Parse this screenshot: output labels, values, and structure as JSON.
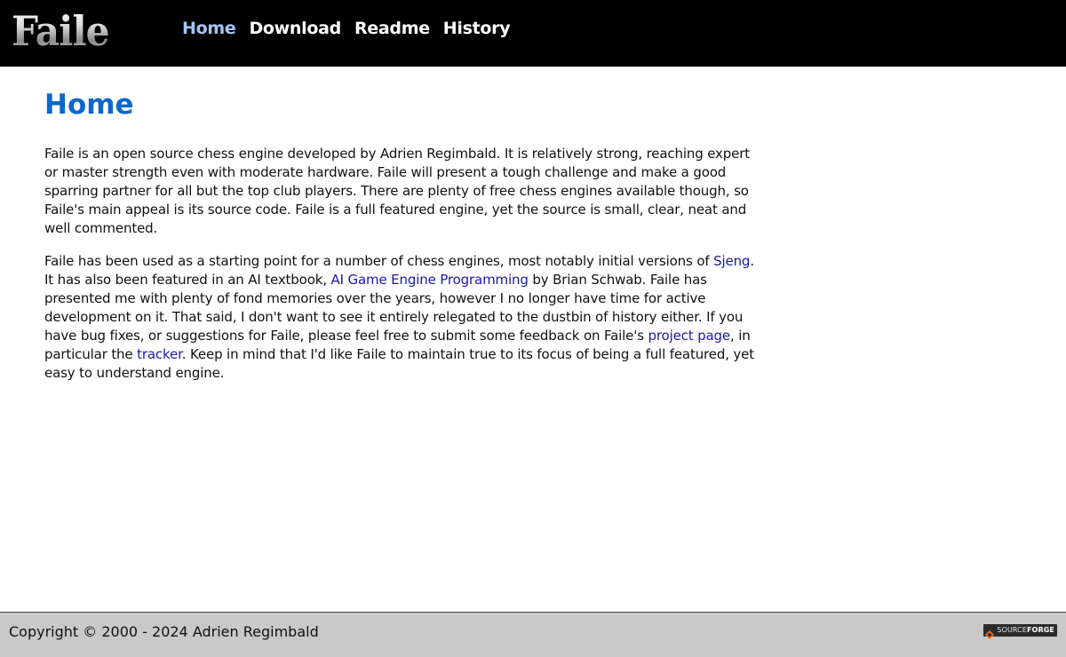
{
  "header": {
    "logo_text": "Faile",
    "nav": [
      {
        "label": "Home",
        "active": true
      },
      {
        "label": "Download",
        "active": false
      },
      {
        "label": "Readme",
        "active": false
      },
      {
        "label": "History",
        "active": false
      }
    ]
  },
  "main": {
    "title": "Home",
    "p1": "Faile is an open source chess engine developed by Adrien Regimbald. It is relatively strong, reaching expert or master strength even with moderate hardware. Faile will present a tough challenge and make a good sparring partner for all but the top club players. There are plenty of free chess engines available though, so Faile's main appeal is its source code. Faile is a full featured engine, yet the source is small, clear, neat and well commented.",
    "p2": {
      "t1": "Faile has been used as a starting point for a number of chess engines, most notably initial versions of ",
      "link_sjeng": "Sjeng",
      "t2": ". It has also been featured in an AI textbook, ",
      "link_book": "AI Game Engine Programming",
      "t3": " by Brian Schwab. Faile has presented me with plenty of fond memories over the years, however I no longer have time for active development on it. That said, I don't want to see it entirely relegated to the dustbin of history either. If you have bug fixes, or suggestions for Faile, please feel free to submit some feedback on Faile's ",
      "link_project": "project page",
      "t4": ", in particular the ",
      "link_tracker": "tracker",
      "t5": ". Keep in mind that I'd like Faile to maintain true to its focus of being a full featured, yet easy to understand engine."
    }
  },
  "footer": {
    "copyright": "Copyright © 2000 - 2024 Adrien Regimbald",
    "badge_source": "SOURCE",
    "badge_forge": "FORGE",
    "badge_icon": "sourceforge-logo-icon"
  },
  "colors": {
    "header_bg": "#000000",
    "nav_active": "#a3c7f5",
    "title": "#0f67c9",
    "link": "#1a1aa6",
    "footer_bg": "#c9c9c9",
    "sf_orange": "#f26b1d"
  }
}
